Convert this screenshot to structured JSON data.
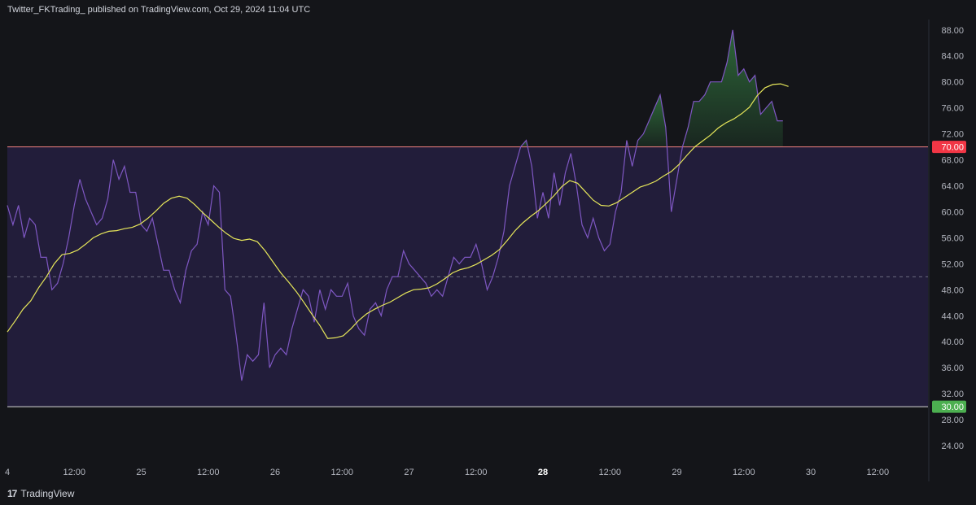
{
  "header": {
    "publisher_line": "Twitter_FKTrading_ published on TradingView.com, Oct 29, 2024 11:04 UTC"
  },
  "footer": {
    "logo_glyph": "17",
    "brand": "TradingView"
  },
  "colors": {
    "background": "#141519",
    "band_fill": "#221d3a",
    "rsi_line": "#7e57c2",
    "ma_line": "#e6e65a",
    "overbought_line": "#f08080",
    "oversold_line": "#d9d9d9",
    "overbought_badge": "#f23645",
    "oversold_badge": "#4caf50",
    "overbought_fill": "#2e6b3a",
    "midline": "#6b6b80"
  },
  "chart_data": {
    "type": "line",
    "title": "",
    "xlabel": "",
    "ylabel": "",
    "ylim": [
      21.5,
      89.6
    ],
    "xlim": [
      0,
      165
    ],
    "grid": false,
    "y_ticks": [
      "24.00",
      "28.00",
      "32.00",
      "36.00",
      "40.00",
      "44.00",
      "48.00",
      "52.00",
      "56.00",
      "60.00",
      "64.00",
      "68.00",
      "72.00",
      "76.00",
      "80.00",
      "84.00",
      "88.00"
    ],
    "x_tick_labels": [
      {
        "label": "4",
        "x": 0,
        "bold": false
      },
      {
        "label": "12:00",
        "x": 12,
        "bold": false
      },
      {
        "label": "25",
        "x": 24,
        "bold": false
      },
      {
        "label": "12:00",
        "x": 36,
        "bold": false
      },
      {
        "label": "26",
        "x": 48,
        "bold": false
      },
      {
        "label": "12:00",
        "x": 60,
        "bold": false
      },
      {
        "label": "27",
        "x": 72,
        "bold": false
      },
      {
        "label": "12:00",
        "x": 84,
        "bold": false
      },
      {
        "label": "28",
        "x": 96,
        "bold": true
      },
      {
        "label": "12:00",
        "x": 108,
        "bold": false
      },
      {
        "label": "29",
        "x": 120,
        "bold": false
      },
      {
        "label": "12:00",
        "x": 132,
        "bold": false
      },
      {
        "label": "30",
        "x": 144,
        "bold": false
      },
      {
        "label": "12:00",
        "x": 156,
        "bold": false
      }
    ],
    "levels": {
      "upper": 70,
      "middle": 50,
      "lower": 30
    },
    "level_labels": {
      "upper": "70.00",
      "lower": "30.00"
    },
    "series": [
      {
        "values": [
          61,
          58,
          61,
          56,
          59,
          58,
          53,
          53,
          48,
          49,
          52,
          56,
          61,
          65,
          62,
          60,
          58,
          59,
          62,
          68,
          65,
          67,
          63,
          63,
          58,
          57,
          59,
          55,
          51,
          51,
          48,
          46,
          51,
          54,
          55,
          60,
          58,
          64,
          63,
          48,
          47,
          41,
          34,
          38,
          37,
          38,
          46,
          36,
          38,
          39,
          38,
          42,
          45,
          48,
          47,
          43,
          48,
          45,
          48,
          47,
          47,
          49,
          44,
          42,
          41,
          45,
          46,
          44,
          48,
          50,
          50,
          54,
          52,
          51,
          50,
          49,
          47,
          48,
          47,
          50,
          53,
          52,
          53,
          53,
          55,
          52,
          48,
          50,
          53,
          57,
          64,
          67,
          70,
          71,
          67,
          59,
          63,
          59,
          66,
          61,
          66,
          69,
          64,
          58,
          56,
          59,
          56,
          54,
          55,
          60,
          63,
          71,
          67,
          71,
          72,
          74,
          76,
          78,
          73,
          60,
          65,
          70,
          73,
          77,
          77,
          78,
          80,
          80,
          80,
          83,
          88,
          81,
          82,
          80,
          81,
          75,
          76,
          77,
          74,
          74
        ],
        "x_start": 0,
        "x_step": 1
      },
      {
        "values": [
          41.5,
          43.2,
          45,
          46.3,
          48.3,
          50,
          52,
          53.4,
          53.6,
          54.1,
          55,
          56,
          56.6,
          57,
          57.1,
          57.4,
          57.6,
          58.1,
          59,
          60.1,
          61.3,
          62.1,
          62.4,
          62.1,
          61.1,
          59.9,
          58.8,
          57.7,
          56.7,
          55.9,
          55.6,
          55.8,
          55.4,
          54,
          52.3,
          50.6,
          49.2,
          47.7,
          46,
          44.2,
          42.5,
          40.5,
          40.6,
          40.9,
          42,
          43.3,
          44.3,
          45,
          45.6,
          46.1,
          46.8,
          47.5,
          48,
          48.1,
          48.3,
          48.9,
          49.7,
          50.6,
          51.1,
          51.4,
          51.9,
          52.6,
          53.3,
          54.2,
          55.6,
          57.1,
          58.3,
          59.3,
          60.2,
          61.3,
          62.5,
          63.9,
          64.8,
          64.4,
          63.1,
          61.8,
          61,
          60.9,
          61.4,
          62.2,
          63,
          63.8,
          64.2,
          64.7,
          65.5,
          66.2,
          67.3,
          68.7,
          70,
          70.9,
          71.8,
          72.9,
          73.7,
          74.3,
          75.1,
          76.1,
          77.9,
          79.1,
          79.6,
          79.7,
          79.3
        ],
        "x_start": 0,
        "x_step": 1.4
      }
    ]
  }
}
